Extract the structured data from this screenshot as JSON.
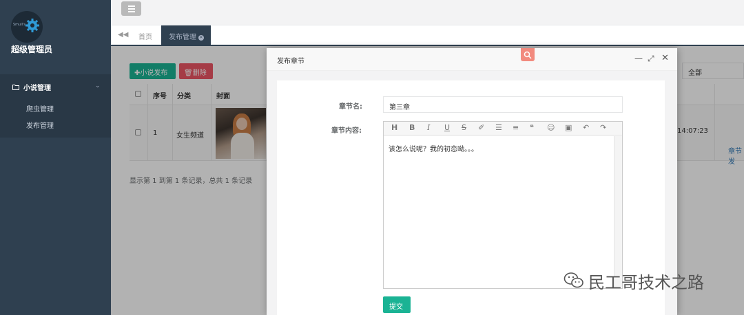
{
  "sidebar": {
    "logo_text": "Smull's",
    "profile_name": "超级管理员",
    "menu_group": "小说管理",
    "menu_items": [
      "爬虫管理",
      "发布管理"
    ]
  },
  "tabs": {
    "home": "首页",
    "active": "发布管理"
  },
  "toolbar": {
    "add_label": "✚小说发布",
    "delete_label": "🗑删除",
    "filter_value": "全部"
  },
  "table": {
    "headers": [
      "序号",
      "分类",
      "封面"
    ],
    "rows": [
      {
        "index": "1",
        "category": "女生频道",
        "time": "14:07:23",
        "action": "章节发"
      }
    ],
    "footer": "显示第 1 到第 1 条记录，总共 1 条记录"
  },
  "modal": {
    "title": "发布章节",
    "chapter_name_label": "章节名:",
    "chapter_name_value": "第三章",
    "content_label": "章节内容:",
    "content_text": "该怎么说呢？我的初恋呦。。。",
    "submit_label": "提交",
    "editor_tools": [
      "H",
      "B",
      "I",
      "U",
      "S",
      "✐",
      "☰",
      "≡",
      "❝",
      "☺",
      "▣",
      "↶",
      "↷"
    ]
  },
  "watermark": "民工哥技术之路",
  "colors": {
    "sidebar": "#2f4050",
    "primary": "#1ab394",
    "danger": "#ed5565"
  }
}
